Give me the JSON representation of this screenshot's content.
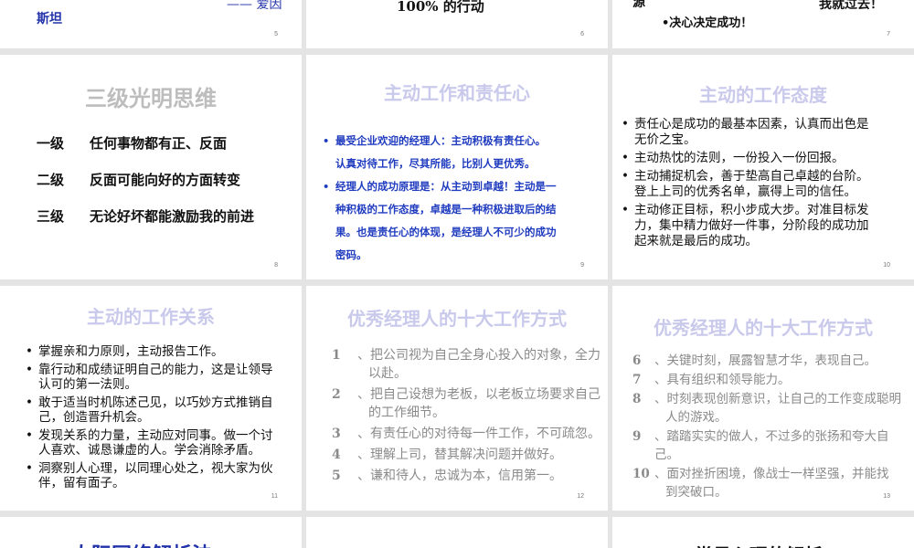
{
  "row1": {
    "s5": {
      "left_text": "斯坦",
      "right_text": "—— 爱因",
      "num": "5"
    },
    "s6": {
      "text": "100% 的行动",
      "num": "6"
    },
    "s7": {
      "left_text": "源",
      "right_text": "我就过去！",
      "bullet": "•决心决定成功！",
      "num": "7"
    }
  },
  "s8": {
    "title": "三级光明思维",
    "levels": [
      {
        "name": "一级",
        "text": "任何事物都有正、反面"
      },
      {
        "name": "二级",
        "text": "反面可能向好的方面转变"
      },
      {
        "name": "三级",
        "text": "无论好坏都能激励我的前进"
      }
    ],
    "num": "8"
  },
  "s9": {
    "title": "主动工作和责任心",
    "bullets": [
      {
        "lines": [
          "最受企业欢迎的经理人：主动积极有责任心。",
          "认真对待工作，尽其所能，比别人更优秀。"
        ]
      },
      {
        "lines": [
          "经理人的成功原理是：从主动到卓越！主动是一",
          "种积极的工作态度，卓越是一种积极进取后的结",
          "果。也是责任心的体现，是经理人不可少的成功",
          "密码。"
        ]
      }
    ],
    "num": "9"
  },
  "s10": {
    "title": "主动的工作态度",
    "bullets": [
      {
        "lines": [
          "责任心是成功的最基本因素，认真而出色是",
          "无价之宝。"
        ]
      },
      {
        "lines": [
          "主动热忱的法则，一份投入一份回报。"
        ]
      },
      {
        "lines": [
          "主动捕捉机会，善于垫高自己卓越的台阶。",
          "登上上司的优秀名单，赢得上司的信任。"
        ]
      },
      {
        "lines": [
          "主动修正目标，积小步成大步。对准目标发",
          "力，集中精力做好一件事，分阶段的成功加",
          "起来就是最后的成功。"
        ]
      }
    ],
    "num": "10"
  },
  "s11": {
    "title": "主动的工作关系",
    "bullets": [
      {
        "lines": [
          "掌握亲和力原则，主动报告工作。"
        ]
      },
      {
        "lines": [
          "靠行动和成绩证明自己的能力，这是让领导",
          "认可的第一法则。"
        ]
      },
      {
        "lines": [
          "敢于适当时机陈述己见，以巧妙方式推销自",
          "己，创造晋升机会。"
        ]
      },
      {
        "lines": [
          "发现关系的力量，主动应对同事。做一个讨",
          "人喜欢、诚恳谦虚的人。学会消除矛盾。"
        ]
      },
      {
        "lines": [
          "洞察别人心理，以同理心处之，视大家为伙",
          "伴，留有面子。"
        ]
      }
    ],
    "num": "11"
  },
  "s12": {
    "title": "优秀经理人的十大工作方式",
    "items": [
      {
        "n": "1",
        "lines": [
          "、把公司视为自己全身心投入的对象，全力",
          "以赴。"
        ]
      },
      {
        "n": "2",
        "lines": [
          "、把自己设想为老板，以老板立场要求自己",
          "的工作细节。"
        ]
      },
      {
        "n": "3",
        "lines": [
          "、有责任心的对待每一件工作，不可疏忽。"
        ]
      },
      {
        "n": "4",
        "lines": [
          "、理解上司，替其解决问题并做好。"
        ]
      },
      {
        "n": "5",
        "lines": [
          "、谦和待人，忠诚为本，信用第一。"
        ]
      }
    ],
    "num": "12"
  },
  "s13": {
    "title": "优秀经理人的十大工作方式",
    "items": [
      {
        "n": "6",
        "lines": [
          "、关键时刻，展露智慧才华，表现自己。"
        ]
      },
      {
        "n": "7",
        "lines": [
          "、具有组织和领导能力。"
        ]
      },
      {
        "n": "8",
        "lines": [
          "、时刻表现创新意识，让自己的工作变成聪明",
          "人的游戏。"
        ]
      },
      {
        "n": "9",
        "lines": [
          "、踏踏实实的做人，不过多的张扬和夸大自己。"
        ]
      },
      {
        "n": "10",
        "lines": [
          "、面对挫折困境，像战士一样坚强，并能找",
          "到突破口。"
        ]
      }
    ],
    "num": "13"
  },
  "row4": {
    "left_partial": "人际网络解析法",
    "right_partial": "常见心理的解析"
  }
}
